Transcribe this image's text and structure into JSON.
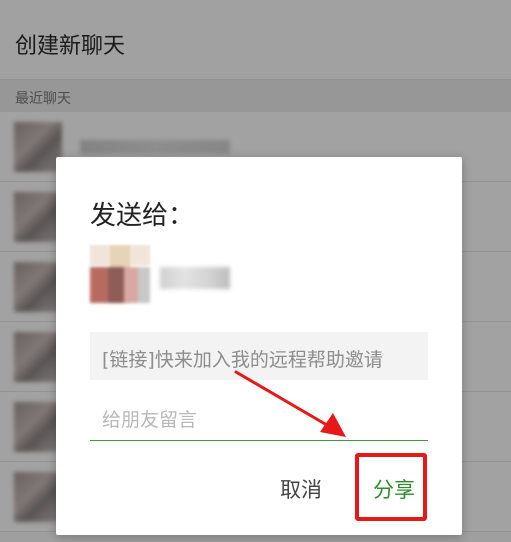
{
  "background": {
    "header_title": "创建新聊天",
    "section_label": "最近聊天"
  },
  "dialog": {
    "title": "发送给：",
    "link_text": "[链接]快来加入我的远程帮助邀请",
    "message_placeholder": "给朋友留言",
    "cancel_label": "取消",
    "share_label": "分享"
  },
  "annotation": {
    "highlight_color": "#e81818",
    "arrow_color": "#e81818"
  },
  "colors": {
    "accent_green": "#2e8b2e"
  }
}
